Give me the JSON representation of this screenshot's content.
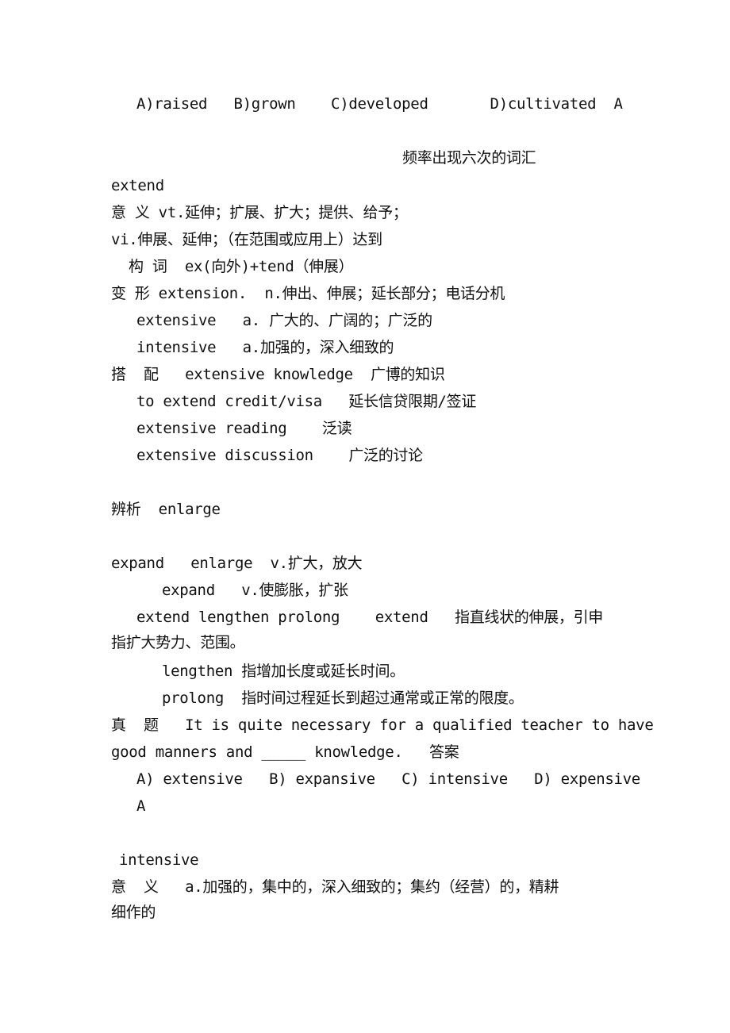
{
  "document": {
    "lines": [
      "A)raised   B)grown    C)developed       D)cultivated  A",
      "频率出现六次的词汇",
      "extend",
      "意 义 vt.延伸；扩展、扩大；提供、给予；",
      "vi.伸展、延伸；（在范围或应用上）达到",
      "构 词  ex(向外)+tend（伸展）",
      "变 形 extension.  n.伸出、伸展；延长部分；电话分机",
      "extensive   a. 广大的、广阔的；广泛的",
      "intensive   a.加强的，深入细致的",
      "搭  配   extensive knowledge  广博的知识",
      "to extend credit/visa   延长信贷限期/签证",
      "extensive reading    泛读",
      "extensive discussion    广泛的讨论",
      "辨析  enlarge",
      "expand   enlarge  v.扩大，放大",
      "expand   v.使膨胀，扩张",
      "extend lengthen prolong    extend   指直线状的伸展，引申",
      "指扩大势力、范围。",
      "lengthen 指增加长度或延长时间。",
      "prolong  指时间过程延长到超过通常或正常的限度。",
      "真  题   It is quite necessary for a qualified teacher to have",
      "good manners and _____ knowledge.   答案",
      "A) extensive   B) expansive   C) intensive   D) expensive",
      "A",
      "intensive",
      "意  义   a.加强的，集中的，深入细致的；集约（经营）的，精耕",
      "细作的"
    ]
  }
}
